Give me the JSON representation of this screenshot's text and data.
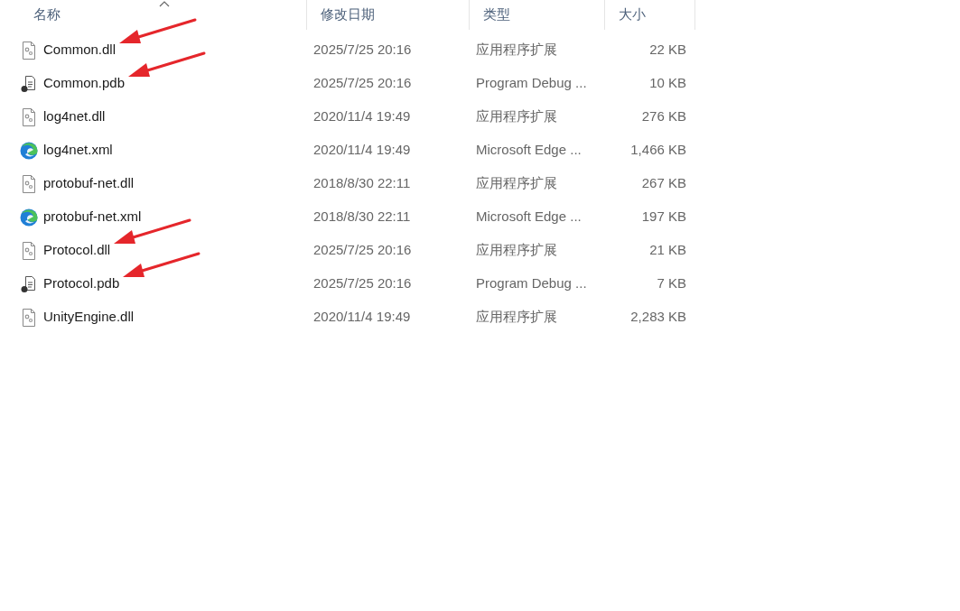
{
  "columns": [
    {
      "label": "名称",
      "sorted": true
    },
    {
      "label": "修改日期",
      "sorted": false
    },
    {
      "label": "类型",
      "sorted": false
    },
    {
      "label": "大小",
      "sorted": false
    }
  ],
  "files": [
    {
      "name": "Common.dll",
      "kind": "dll",
      "modified": "2025/7/25 20:16",
      "type": "应用程序扩展",
      "size": "22 KB",
      "annotated": true
    },
    {
      "name": "Common.pdb",
      "kind": "pdb",
      "modified": "2025/7/25 20:16",
      "type": "Program Debug ...",
      "size": "10 KB",
      "annotated": true
    },
    {
      "name": "log4net.dll",
      "kind": "dll",
      "modified": "2020/11/4 19:49",
      "type": "应用程序扩展",
      "size": "276 KB",
      "annotated": false
    },
    {
      "name": "log4net.xml",
      "kind": "edge",
      "modified": "2020/11/4 19:49",
      "type": "Microsoft Edge ...",
      "size": "1,466 KB",
      "annotated": false
    },
    {
      "name": "protobuf-net.dll",
      "kind": "dll",
      "modified": "2018/8/30 22:11",
      "type": "应用程序扩展",
      "size": "267 KB",
      "annotated": false
    },
    {
      "name": "protobuf-net.xml",
      "kind": "edge",
      "modified": "2018/8/30 22:11",
      "type": "Microsoft Edge ...",
      "size": "197 KB",
      "annotated": false
    },
    {
      "name": "Protocol.dll",
      "kind": "dll",
      "modified": "2025/7/25 20:16",
      "type": "应用程序扩展",
      "size": "21 KB",
      "annotated": true
    },
    {
      "name": "Protocol.pdb",
      "kind": "pdb",
      "modified": "2025/7/25 20:16",
      "type": "Program Debug ...",
      "size": "7 KB",
      "annotated": true
    },
    {
      "name": "UnityEngine.dll",
      "kind": "dll",
      "modified": "2020/11/4 19:49",
      "type": "应用程序扩展",
      "size": "2,283 KB",
      "annotated": false
    }
  ]
}
